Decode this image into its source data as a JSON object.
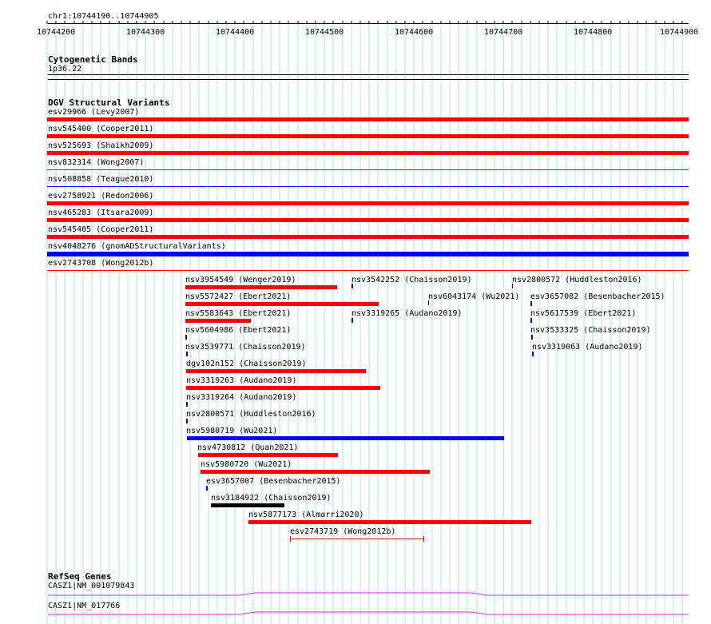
{
  "location": "chr1:10744190..10744905",
  "ruler": {
    "ticks": [
      "10744200",
      "10744300",
      "10744400",
      "10744500",
      "10744600",
      "10744700",
      "10744800",
      "10744900"
    ]
  },
  "cytobands": {
    "title": "Cytogenetic Bands",
    "band": "1p36.22"
  },
  "dgv": {
    "title": "DGV Structural Variants",
    "rows": [
      {
        "label": "esv29966 (Levy2007)"
      },
      {
        "label": "nsv545400 (Cooper2011)"
      },
      {
        "label": "nsv525693 (Shaikh2009)"
      },
      {
        "label": "nsv832314 (Wong2007)"
      },
      {
        "label": "nsv508858 (Teague2010)"
      },
      {
        "label": "esv2758921 (Redon2006)"
      },
      {
        "label": "nsv465283 (Itsara2009)"
      },
      {
        "label": "nsv545405 (Cooper2011)"
      },
      {
        "label": "nsv4048276 (gnomADStructuralVariants)"
      },
      {
        "label": "esv2743708 (Wong2012b)"
      }
    ],
    "packed": [
      {
        "label": "nsv3954549 (Wenger2019)"
      },
      {
        "label": "nsv3542252 (Chaisson2019)"
      },
      {
        "label": "nsv2800572 (Huddleston2016)"
      },
      {
        "label": "nsv5572427 (Ebert2021)"
      },
      {
        "label": "nsv6043174 (Wu2021)"
      },
      {
        "label": "esv3657082 (Besenbacher2015)"
      },
      {
        "label": "nsv5583643 (Ebert2021)"
      },
      {
        "label": "nsv3319265 (Audano2019)"
      },
      {
        "label": "nsv5617539 (Ebert2021)"
      },
      {
        "label": "nsv5604986 (Ebert2021)"
      },
      {
        "label": "nsv3533325 (Chaisson2019)"
      },
      {
        "label": "nsv3539771 (Chaisson2019)"
      },
      {
        "label": "nsv3319063 (Audano2019)"
      },
      {
        "label": "dgv102n152 (Chaisson2019)"
      },
      {
        "label": "nsv3319263 (Audano2019)"
      },
      {
        "label": "nsv3319264 (Audano2019)"
      },
      {
        "label": "nsv2800571 (Huddleston2016)"
      },
      {
        "label": "nsv5980719 (Wu2021)"
      },
      {
        "label": "nsv4730812 (Quan2021)"
      },
      {
        "label": "nsv5980720 (Wu2021)"
      },
      {
        "label": "esv3657007 (Besenbacher2015)"
      },
      {
        "label": "nsv3184922 (Chaisson2019)"
      },
      {
        "label": "nsv5877173 (Almarri2020)"
      },
      {
        "label": "esv2743719 (Wong2012b)"
      }
    ]
  },
  "refseq": {
    "title": "RefSeq Genes",
    "genes": [
      {
        "label": "CASZ1|NM_001079843"
      },
      {
        "label": "CASZ1|NM_017766"
      }
    ]
  },
  "colors": {
    "gain": "#ff0000",
    "loss": "#0000ff",
    "complex": "#000000",
    "gene": "#cc33cc",
    "grid": "#a8e4ec"
  }
}
